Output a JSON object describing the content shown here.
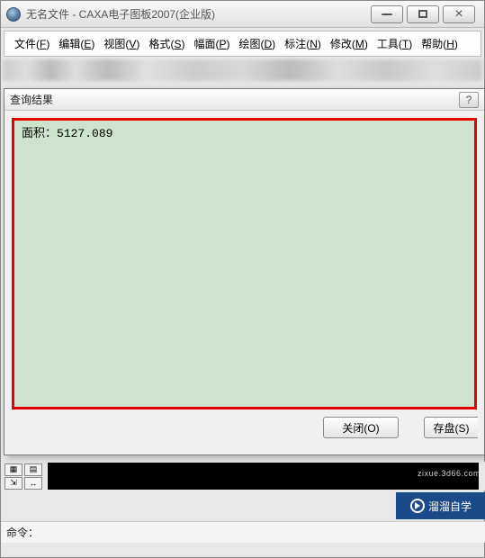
{
  "app": {
    "title": "无名文件 - CAXA电子图板2007(企业版)"
  },
  "menus": {
    "file": {
      "label": "文件",
      "accel": "F"
    },
    "edit": {
      "label": "编辑",
      "accel": "E"
    },
    "view": {
      "label": "视图",
      "accel": "V"
    },
    "format": {
      "label": "格式",
      "accel": "S"
    },
    "frame": {
      "label": "幅面",
      "accel": "P"
    },
    "draw": {
      "label": "绘图",
      "accel": "D"
    },
    "annot": {
      "label": "标注",
      "accel": "N"
    },
    "modify": {
      "label": "修改",
      "accel": "M"
    },
    "tools": {
      "label": "工具",
      "accel": "T"
    },
    "help": {
      "label": "帮助",
      "accel": "H"
    }
  },
  "dialog": {
    "title": "查询结果",
    "result_label": "面积：",
    "result_value": "5127.089",
    "buttons": {
      "close": "关闭(O)",
      "save": "存盘(S)"
    }
  },
  "commandline": {
    "label": "命令："
  },
  "watermark": {
    "text": "溜溜自学",
    "url": "zixue.3d66.com"
  }
}
